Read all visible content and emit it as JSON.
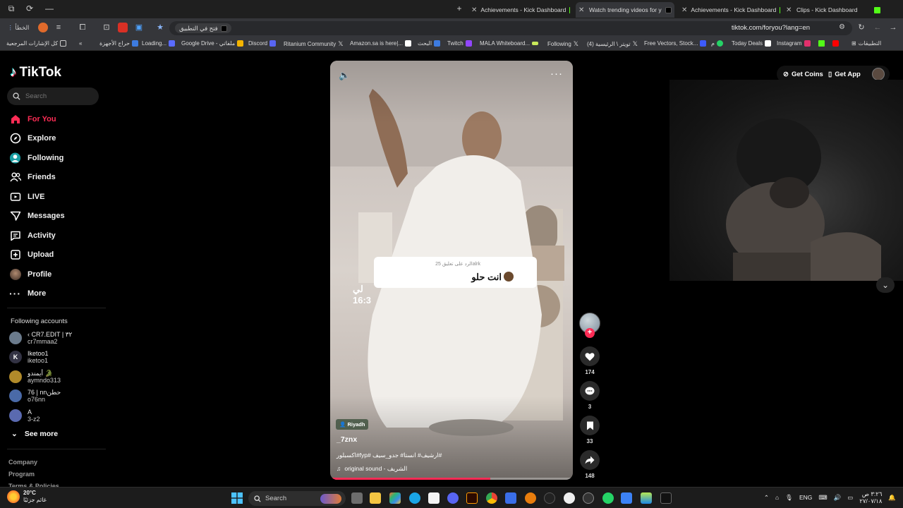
{
  "browser": {
    "tabs": [
      {
        "title": "Achievements - Kick Dashboard",
        "icon": "kick-icon",
        "active": false
      },
      {
        "title": "Watch trending videos for y",
        "icon": "tiktok-icon",
        "active": true
      },
      {
        "title": "Achievements - Kick Dashboard",
        "icon": "kick-icon",
        "active": false
      },
      {
        "title": "Clips - Kick Dashboard",
        "icon": "kick-icon",
        "active": false
      }
    ],
    "url": "tiktok.com/foryou?lang=en",
    "open_in_app_label": "فتح في التطبيق",
    "profile_label": "الخطأ",
    "bookmarks": [
      {
        "label": "كل الإشارات المرجعية",
        "color": "#888888"
      },
      {
        "label": "حراج الأجهزة",
        "color": "#3d7be0"
      },
      {
        "label": "Loading...",
        "color": "#5a6bff"
      },
      {
        "label": "Google Drive - ملفاتي",
        "color": "#f4b400"
      },
      {
        "label": "Discord",
        "color": "#5865f2"
      },
      {
        "label": "Ritanium Community",
        "color": "#222222"
      },
      {
        "label": "Amazon.sa is here|...",
        "color": "#ffffff"
      },
      {
        "label": "البحث",
        "color": "#3d7be0"
      },
      {
        "label": "Twitch",
        "color": "#9146ff"
      },
      {
        "label": "MALA Whiteboard...",
        "color": "#c8e85a"
      },
      {
        "label": "Following",
        "color": "#222222"
      },
      {
        "label": "(4) تويتر \\ الرئيسية",
        "color": "#222222"
      },
      {
        "label": "Free Vectors, Stock...",
        "color": "#3d5bff"
      },
      {
        "label": "م",
        "color": "#25d366"
      },
      {
        "label": "Today Deals",
        "color": "#ffffff"
      },
      {
        "label": "Instagram",
        "color": "#e1306c"
      },
      {
        "label": "التطبيقات",
        "color": "#888888"
      }
    ]
  },
  "tiktok": {
    "logo": "TikTok",
    "search_placeholder": "Search",
    "nav": [
      {
        "label": "For You",
        "icon": "home-icon",
        "selected": true
      },
      {
        "label": "Explore",
        "icon": "compass-icon",
        "selected": false
      },
      {
        "label": "Following",
        "icon": "following-icon",
        "selected": false
      },
      {
        "label": "Friends",
        "icon": "friends-icon",
        "selected": false
      },
      {
        "label": "LIVE",
        "icon": "live-icon",
        "selected": false
      },
      {
        "label": "Messages",
        "icon": "messages-icon",
        "selected": false
      },
      {
        "label": "Activity",
        "icon": "activity-icon",
        "selected": false
      },
      {
        "label": "Upload",
        "icon": "upload-icon",
        "selected": false
      },
      {
        "label": "Profile",
        "icon": "profile-icon",
        "selected": false
      },
      {
        "label": "More",
        "icon": "more-icon",
        "selected": false
      }
    ],
    "following_title": "Following accounts",
    "accounts": [
      {
        "name": "‹ CR7.EDIT | ٣٢",
        "handle": "cr7mmaa2",
        "color": "#6b7b8c"
      },
      {
        "name": "Iketoo1",
        "handle": "iketoo1",
        "color": "#333344"
      },
      {
        "name": "أيمندو 🐊",
        "handle": "aymndo313",
        "color": "#b08a2a"
      },
      {
        "name": "76 | nnحطن",
        "handle": "o76nn",
        "color": "#4a6aa8"
      },
      {
        "name": "A",
        "handle": "3-z2",
        "color": "#5a6ab0"
      }
    ],
    "see_more": "See more",
    "footer": [
      "Company",
      "Program",
      "Terms & Policies"
    ],
    "get_coins": "Get Coins",
    "get_app": "Get App"
  },
  "video": {
    "location": "Riyadh",
    "username": "_7znx",
    "caption": "اكسبلور#fyp# ارشيف# انستا# جدو_سيف#",
    "sound": "original sound - الشريف",
    "comment_header": "الرد على تعليق 25alrk",
    "comment_text": "انت حلو",
    "overlay_text": "لي 16:3",
    "progress": 0.66,
    "likes": "174",
    "comments": "3",
    "saves": "33",
    "shares": "148"
  },
  "taskbar": {
    "temperature": "20°C",
    "weather_desc": "غائم جزئيًا",
    "search_label": "Search",
    "language": "ENG",
    "time": "٣:٢٦ ص",
    "date": "٢٧/٠٧/١٨"
  }
}
